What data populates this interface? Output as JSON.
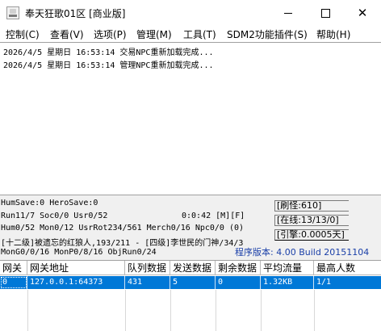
{
  "window": {
    "title": "奉天狂歌01区 [商业版]"
  },
  "menu": [
    {
      "label": "控制(C)"
    },
    {
      "label": "查看(V)"
    },
    {
      "label": "选项(P)"
    },
    {
      "label": "管理(M)"
    },
    {
      "label": "工具(T)"
    },
    {
      "label": "SDM2功能插件(S)"
    },
    {
      "label": "帮助(H)"
    }
  ],
  "log": [
    "2026/4/5 星期日 16:53:14 交易NPC重新加载完成...",
    "2026/4/5 星期日 16:53:14 管理NPC重新加载完成..."
  ],
  "status": {
    "line1": "HumSave:0 HeroSave:0",
    "line2": "Run11/7 Soc0/0 Usr0/52",
    "time": "0:0:42 [M][F]",
    "line3": "Hum0/52 Mon0/12 UsrRot234/561 Merch0/16 Npc0/0 (0)",
    "line4": "[十二级]被遗忘的红狼人,193/211 - [四级]李世民的门神/34/3",
    "line5": "MonG0/0/16 MonP0/8/16 ObjRun0/24",
    "refresh": "[刷怪:610]",
    "online": "[在线:13/13/0]",
    "engine": "[引擎:0.0005天]",
    "version": "程序版本: 4.00 Build 20151104"
  },
  "gateway_table": {
    "columns": [
      "网关",
      "网关地址",
      "队列数据",
      "发送数据",
      "剩余数据",
      "平均流量",
      "最高人数"
    ],
    "rows": [
      [
        "0",
        "127.0.0.1:64373",
        "431",
        "5",
        "0",
        "1.32KB",
        "1/1"
      ]
    ]
  },
  "colors": {
    "selection": "#0078d7",
    "version_text": "#1a3fa8"
  },
  "icons": {
    "app": "app-icon",
    "minimize": "minimize-icon",
    "maximize": "maximize-icon",
    "close": "close-icon"
  }
}
